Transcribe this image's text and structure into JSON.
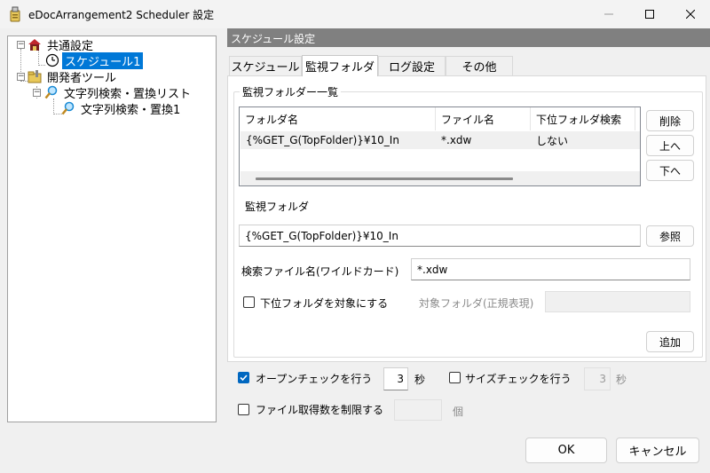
{
  "window": {
    "title": "eDocArrangement2 Scheduler 設定",
    "icons": {
      "app": "app-icon",
      "minimize": "minimize-icon",
      "maximize": "maximize-icon",
      "close": "close-icon"
    }
  },
  "tree": {
    "items": [
      {
        "label": "共通設定",
        "icon": "house-icon",
        "expander": "−"
      },
      {
        "label": "スケジュール1",
        "icon": "clock-icon",
        "selected": true
      },
      {
        "label": "開発者ツール",
        "icon": "folder-tools-icon",
        "expander": "−"
      },
      {
        "label": "文字列検索・置換リスト",
        "icon": "magnifier-icon",
        "expander": "−"
      },
      {
        "label": "文字列検索・置換1",
        "icon": "magnifier-icon"
      }
    ]
  },
  "panel": {
    "header": "スケジュール設定",
    "tabs": [
      {
        "label": "スケジュール"
      },
      {
        "label": "監視フォルダ",
        "active": true
      },
      {
        "label": "ログ設定"
      },
      {
        "label": "その他"
      }
    ]
  },
  "monitor": {
    "group_label": "監視フォルダー一覧",
    "columns": [
      "フォルダ名",
      "ファイル名",
      "下位フォルダ検索"
    ],
    "rows": [
      [
        "{%GET_G(TopFolder)}¥10_In",
        "*.xdw",
        "しない"
      ]
    ],
    "buttons": {
      "delete": "削除",
      "up": "上へ",
      "down": "下へ",
      "browse": "参照",
      "add": "追加"
    },
    "folder_label": "監視フォルダ",
    "folder_value": "{%GET_G(TopFolder)}¥10_In",
    "filename_label": "検索ファイル名(ワイルドカード)",
    "filename_value": "*.xdw",
    "subfolder_check_label": "下位フォルダを対象にする",
    "subfolder_checked": false,
    "target_folder_label": "対象フォルダ(正規表現)",
    "target_folder_value": ""
  },
  "options": {
    "open_check_label": "オープンチェックを行う",
    "open_check_checked": true,
    "open_check_value": "3",
    "open_check_unit": "秒",
    "size_check_label": "サイズチェックを行う",
    "size_check_checked": false,
    "size_check_value": "3",
    "size_check_unit": "秒",
    "limit_label": "ファイル取得数を制限する",
    "limit_checked": false,
    "limit_value": "",
    "limit_unit": "個"
  },
  "footer": {
    "ok": "OK",
    "cancel": "キャンセル"
  },
  "colors": {
    "accent": "#0078d7",
    "header_bg": "#808080",
    "window_bg": "#f0f0f0"
  }
}
